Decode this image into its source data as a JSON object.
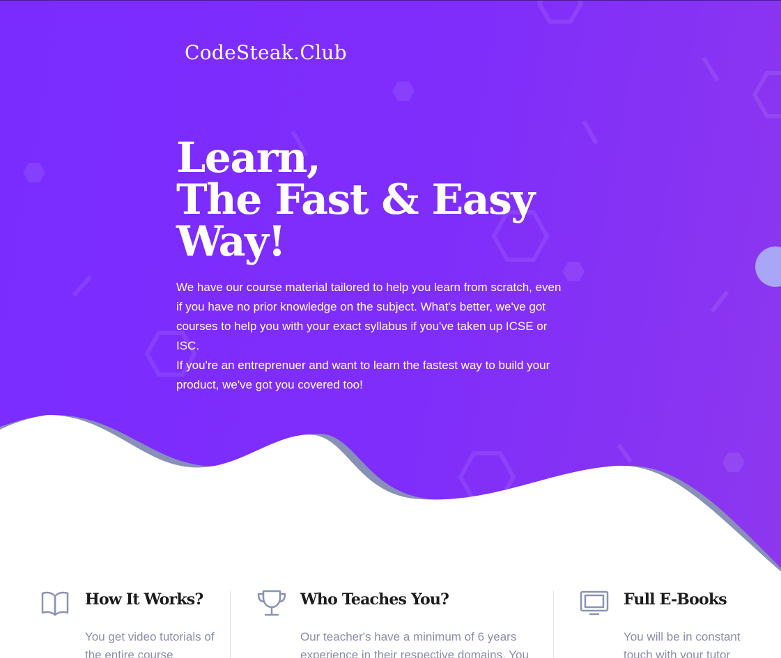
{
  "brand": {
    "logo": "CodeSteak.Club"
  },
  "hero": {
    "headline": [
      "Learn,",
      "The Fast & Easy",
      "Way!"
    ],
    "paragraphs": [
      "We have our course material tailored to help you learn from scratch, even if you have no prior knowledge on the subject. What's better, we've got courses to help you with your exact syllabus if you've taken up ICSE or ISC.",
      "If you're an entreprenuer and want to learn the fastest way to build your product, we've got you covered too!"
    ]
  },
  "features": [
    {
      "icon": "book-icon",
      "title": "How It Works?",
      "text": "You get video tutorials of the entire course"
    },
    {
      "icon": "trophy-icon",
      "title": "Who Teaches You?",
      "text": "Our teacher's have a minimum of 6 years experience in their respective domains. You"
    },
    {
      "icon": "monitor-icon",
      "title": "Full E-Books",
      "text": "You will be in constant touch with your tutor"
    }
  ],
  "colors": {
    "hero_bg": "#7f2dfb",
    "wave_shadow": "#8890b8",
    "heading_text": "#1c1c1c",
    "body_text": "#8a8ea8",
    "icon": "#8a93b3"
  }
}
